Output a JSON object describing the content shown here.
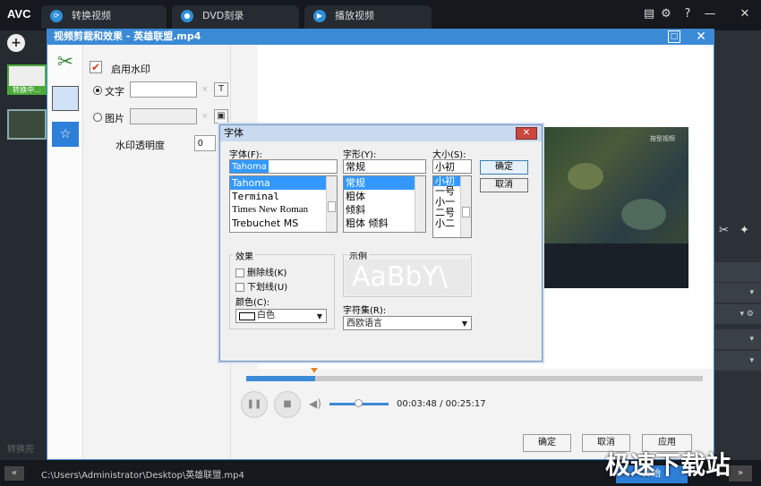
{
  "app": {
    "logo": "AVC",
    "tabs": [
      {
        "label": "转换视频",
        "icon": "convert-icon"
      },
      {
        "label": "DVD刻录",
        "icon": "dvd-icon"
      },
      {
        "label": "播放视频",
        "icon": "play-icon"
      }
    ],
    "controls": {
      "menu_icon": "menu-icon",
      "settings_icon": "gear-icon",
      "help": "?",
      "minimize": "—",
      "close": "✕"
    },
    "thumb_badge": "转换中...",
    "bottom_path": "C:\\Users\\Administrator\\Desktop\\英雄联盟.mp4",
    "bottom_left_btn": "«",
    "bottom_right_btn": "»",
    "bottom_convert": "开始",
    "left_bottom_label": "转换完",
    "watermark": "极速下载站"
  },
  "edit_dialog": {
    "title": "视频剪裁和效果 - 英雄联盟.mp4",
    "enable_watermark_label": "启用水印",
    "enable_watermark_checked": true,
    "text_label": "文字",
    "image_label": "图片",
    "opacity_label": "水印透明度",
    "opacity_value": "0",
    "text_value": "",
    "image_value": "",
    "clear_glyph": "×",
    "text_btn": "T",
    "image_btn": "▣",
    "video_time": "00:03:48 / 00:25:17",
    "progress": 0.15,
    "buttons": {
      "ok": "确定",
      "cancel": "取消",
      "apply": "应用"
    },
    "video_overlay_text": "按型视频"
  },
  "font_dialog": {
    "title": "字体",
    "close_glyph": "✕",
    "font_label": "字体(F):",
    "style_label": "字形(Y):",
    "size_label": "大小(S):",
    "font_value": "Tahoma",
    "style_value": "常规",
    "size_value": "小初",
    "fonts": [
      "Tahoma",
      "Terminal",
      "Times New Roman",
      "Trebuchet MS"
    ],
    "styles": [
      "常规",
      "粗体",
      "倾斜",
      "粗体 倾斜"
    ],
    "sizes": [
      "小初",
      "一号",
      "小一",
      "二号",
      "小二"
    ],
    "ok": "确定",
    "cancel": "取消",
    "effects_label": "效果",
    "strikeout_label": "删除线(K)",
    "underline_label": "下划线(U)",
    "color_label": "颜色(C):",
    "color_value": "白色",
    "sample_label": "示例",
    "sample_text": "AaBbY\\",
    "charset_label": "字符集(R):",
    "charset_value": "西欧语言"
  }
}
